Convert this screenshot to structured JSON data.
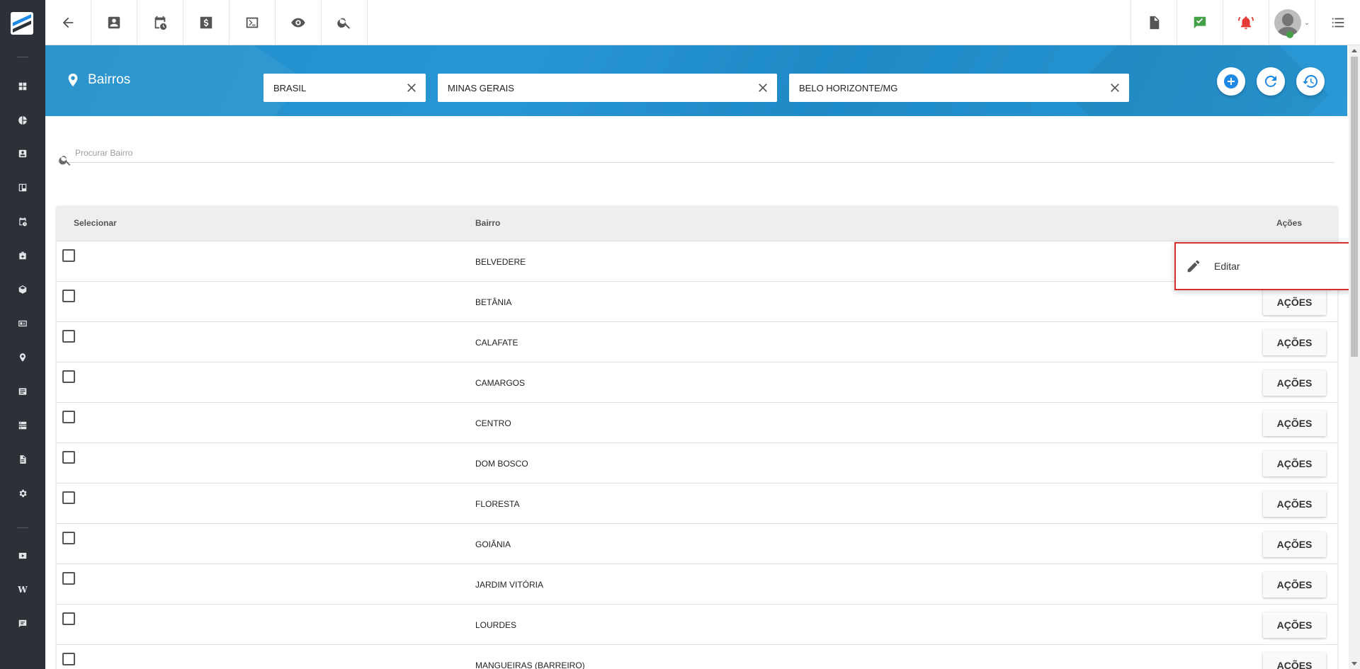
{
  "app": {
    "brand_colors": {
      "sidebar": "#2c3138",
      "banner": "#2196d3",
      "accent": "#1e88e5",
      "menu_highlight": "#d32f2f"
    }
  },
  "sidebar": {
    "items": [
      {
        "icon": "dashboard-icon"
      },
      {
        "icon": "pie-chart-icon"
      },
      {
        "icon": "contact-card-icon"
      },
      {
        "icon": "board-icon"
      },
      {
        "icon": "calendar-clock-icon"
      },
      {
        "icon": "medical-kit-icon"
      },
      {
        "icon": "package-icon"
      },
      {
        "icon": "id-card-icon"
      },
      {
        "icon": "location-person-icon"
      },
      {
        "icon": "list-icon"
      },
      {
        "icon": "server-icon"
      },
      {
        "icon": "document-icon"
      },
      {
        "icon": "settings-icon"
      },
      {
        "icon": "video-icon"
      },
      {
        "icon": "wiki-icon",
        "text": "W"
      },
      {
        "icon": "chat-icon"
      }
    ]
  },
  "topbar": {
    "left_buttons": [
      "back-arrow-icon",
      "contact-card-icon",
      "calendar-clock-icon",
      "dollar-icon",
      "terminal-icon",
      "eye-icon",
      "search-icon"
    ],
    "right_buttons": [
      "pdf-icon",
      "chat-check-icon",
      "notification-bell-icon",
      "user-avatar",
      "menu-list-icon"
    ],
    "caret": "⌄"
  },
  "header": {
    "title": "Bairros",
    "filters": {
      "country": "BRASIL",
      "state": "MINAS GERAIS",
      "city": "BELO HORIZONTE/MG"
    },
    "actions": [
      "add-icon",
      "refresh-icon",
      "history-icon"
    ]
  },
  "search": {
    "placeholder": "Procurar Bairro",
    "value": ""
  },
  "table": {
    "columns": {
      "select": "Selecionar",
      "name": "Bairro",
      "actions": "Ações"
    },
    "action_label": "AÇÕES",
    "rows": [
      {
        "name": "BELVEDERE"
      },
      {
        "name": "BETÂNIA"
      },
      {
        "name": "CALAFATE"
      },
      {
        "name": "CAMARGOS"
      },
      {
        "name": "CENTRO"
      },
      {
        "name": "DOM BOSCO"
      },
      {
        "name": "FLORESTA"
      },
      {
        "name": "GOIÂNIA"
      },
      {
        "name": "JARDIM VITÓRIA"
      },
      {
        "name": "LOURDES"
      },
      {
        "name": "MANGUEIRAS (BARREIRO)"
      }
    ]
  },
  "dropdown": {
    "items": [
      {
        "label": "Editar",
        "icon": "pencil-icon"
      }
    ]
  }
}
